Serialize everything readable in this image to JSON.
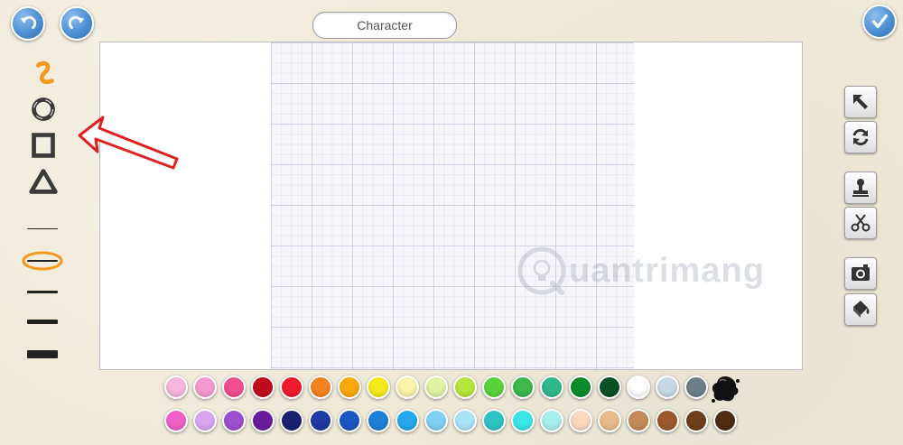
{
  "header": {
    "title": "Character",
    "undo_icon": "undo-icon",
    "redo_icon": "redo-icon",
    "done_icon": "checkmark-icon"
  },
  "watermark": {
    "text": "uantrimang"
  },
  "left_tools": {
    "shapes": [
      "freehand-icon",
      "circle-icon",
      "square-icon",
      "triangle-icon"
    ],
    "selected_shape": "freehand-icon",
    "stroke_sizes": [
      1,
      2,
      3,
      5,
      9
    ],
    "selected_stroke": 2
  },
  "right_tools": [
    "select-arrow-icon",
    "rotate-icon",
    "stamp-icon",
    "scissors-icon",
    "camera-icon",
    "paint-bucket-icon"
  ],
  "colors": {
    "accent": "#4c8fd2",
    "highlight": "#f39a1e",
    "annotation": "#e02020",
    "palette_row1": [
      "#f7b6dd",
      "#f59ad0",
      "#f04f8d",
      "#c00b1c",
      "#ee1b2e",
      "#f4821f",
      "#f9a80b",
      "#f6ea1b",
      "#fbf3a8",
      "#dff3a2",
      "#b5e63a",
      "#5ad23a",
      "#3cb94a",
      "#2fb88a",
      "#0b8a2c",
      "#0b5124",
      "#ffffff",
      "#c7d9e6",
      "#6f7f87"
    ],
    "palette_row2": [
      "#f160c7",
      "#d8a5ef",
      "#9d4fd0",
      "#6b1e9c",
      "#1a1f72",
      "#1f3aa0",
      "#1d57c4",
      "#1e7fd6",
      "#25a8ea",
      "#7fd0f4",
      "#a9e4f6",
      "#2ec4c4",
      "#3be6e6",
      "#a8f0ee",
      "#f9d8c0",
      "#e8bb8c",
      "#c48a58",
      "#9b5a2d",
      "#6e3f1c",
      "#4e2b13"
    ],
    "ink_blot": "#111111"
  }
}
